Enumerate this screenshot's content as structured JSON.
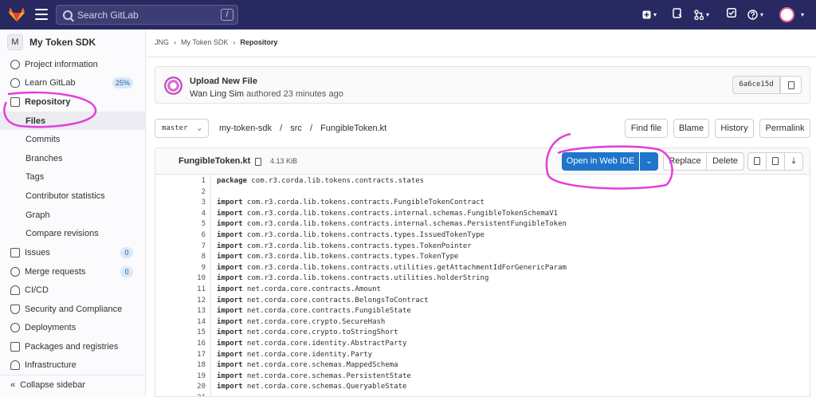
{
  "topbar": {
    "search_placeholder": "Search GitLab",
    "search_shortcut": "/",
    "icons": [
      "tanuki-logo-icon",
      "hamburger-icon",
      "plus-icon",
      "issues-icon",
      "merge-request-icon",
      "todo-icon",
      "help-icon",
      "user-avatar"
    ]
  },
  "sidebar": {
    "project_initial": "M",
    "project_name": "My Token SDK",
    "items": [
      {
        "label": "Project information",
        "icon": "info-icon"
      },
      {
        "label": "Learn GitLab",
        "icon": "bulb-icon",
        "badge": "25%"
      },
      {
        "label": "Repository",
        "icon": "document-icon"
      },
      {
        "label": "Files"
      },
      {
        "label": "Commits"
      },
      {
        "label": "Branches"
      },
      {
        "label": "Tags"
      },
      {
        "label": "Contributor statistics"
      },
      {
        "label": "Graph"
      },
      {
        "label": "Compare revisions"
      },
      {
        "label": "Issues",
        "icon": "issues-icon",
        "badge": "0"
      },
      {
        "label": "Merge requests",
        "icon": "merge-request-icon",
        "badge": "0"
      },
      {
        "label": "CI/CD",
        "icon": "rocket-icon"
      },
      {
        "label": "Security and Compliance",
        "icon": "shield-icon"
      },
      {
        "label": "Deployments",
        "icon": "deploy-icon"
      },
      {
        "label": "Packages and registries",
        "icon": "package-icon"
      },
      {
        "label": "Infrastructure",
        "icon": "cloud-icon"
      }
    ],
    "collapse_label": "Collapse sidebar"
  },
  "breadcrumb": [
    "JNG",
    "My Token SDK",
    "Repository"
  ],
  "commit": {
    "title": "Upload New File",
    "author": "Wan Ling Sim",
    "meta_suffix": "authored 23 minutes ago",
    "sha": "6a6ce15d"
  },
  "file_nav": {
    "branch": "master",
    "path": [
      "my-token-sdk",
      "/",
      "src",
      "/",
      "FungibleToken.kt"
    ],
    "buttons": [
      "Find file",
      "Blame",
      "History",
      "Permalink"
    ]
  },
  "file": {
    "name": "FungibleToken.kt",
    "size": "4.13 KiB",
    "open_web_ide": "Open in Web IDE",
    "replace": "Replace",
    "delete": "Delete"
  },
  "code_lines": [
    {
      "n": "1",
      "kw": "package",
      "rest": " com.r3.corda.lib.tokens.contracts.states"
    },
    {
      "n": "2",
      "kw": "",
      "rest": ""
    },
    {
      "n": "3",
      "kw": "import",
      "rest": " com.r3.corda.lib.tokens.contracts.FungibleTokenContract"
    },
    {
      "n": "4",
      "kw": "import",
      "rest": " com.r3.corda.lib.tokens.contracts.internal.schemas.FungibleTokenSchemaV1"
    },
    {
      "n": "5",
      "kw": "import",
      "rest": " com.r3.corda.lib.tokens.contracts.internal.schemas.PersistentFungibleToken"
    },
    {
      "n": "6",
      "kw": "import",
      "rest": " com.r3.corda.lib.tokens.contracts.types.IssuedTokenType"
    },
    {
      "n": "7",
      "kw": "import",
      "rest": " com.r3.corda.lib.tokens.contracts.types.TokenPointer"
    },
    {
      "n": "8",
      "kw": "import",
      "rest": " com.r3.corda.lib.tokens.contracts.types.TokenType"
    },
    {
      "n": "9",
      "kw": "import",
      "rest": " com.r3.corda.lib.tokens.contracts.utilities.getAttachmentIdForGenericParam"
    },
    {
      "n": "10",
      "kw": "import",
      "rest": " com.r3.corda.lib.tokens.contracts.utilities.holderString"
    },
    {
      "n": "11",
      "kw": "import",
      "rest": " net.corda.core.contracts.Amount"
    },
    {
      "n": "12",
      "kw": "import",
      "rest": " net.corda.core.contracts.BelongsToContract"
    },
    {
      "n": "13",
      "kw": "import",
      "rest": " net.corda.core.contracts.FungibleState"
    },
    {
      "n": "14",
      "kw": "import",
      "rest": " net.corda.core.crypto.SecureHash"
    },
    {
      "n": "15",
      "kw": "import",
      "rest": " net.corda.core.crypto.toStringShort"
    },
    {
      "n": "16",
      "kw": "import",
      "rest": " net.corda.core.identity.AbstractParty"
    },
    {
      "n": "17",
      "kw": "import",
      "rest": " net.corda.core.identity.Party"
    },
    {
      "n": "18",
      "kw": "import",
      "rest": " net.corda.core.schemas.MappedSchema"
    },
    {
      "n": "19",
      "kw": "import",
      "rest": " net.corda.core.schemas.PersistentState"
    },
    {
      "n": "20",
      "kw": "import",
      "rest": " net.corda.core.schemas.QueryableState"
    },
    {
      "n": "21",
      "kw": "",
      "rest": ""
    }
  ],
  "colors": {
    "topbar": "#292961",
    "primary_button": "#1f75cb",
    "annotation": "#e33fd9"
  }
}
